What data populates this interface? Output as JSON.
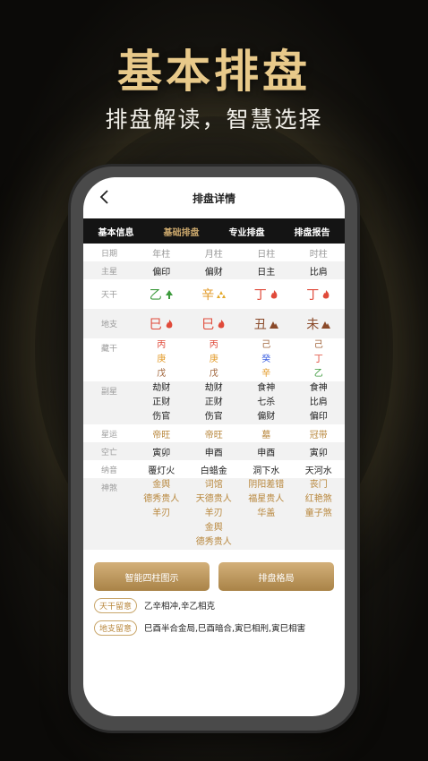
{
  "hero": {
    "title": "基本排盘",
    "subtitle": "排盘解读，智慧选择"
  },
  "nav": {
    "title": "排盘详情"
  },
  "tabs": [
    {
      "label": "基本信息",
      "active": false
    },
    {
      "label": "基础排盘",
      "active": true
    },
    {
      "label": "专业排盘",
      "active": false
    },
    {
      "label": "排盘报告",
      "active": false
    }
  ],
  "table": {
    "header": {
      "label": "日期",
      "cols": [
        "年柱",
        "月柱",
        "日柱",
        "时柱"
      ]
    },
    "zhuxing": {
      "label": "主星",
      "cols": [
        "偏印",
        "偏财",
        "日主",
        "比肩"
      ]
    },
    "tiangan": {
      "label": "天干",
      "cols": [
        {
          "char": "乙",
          "icon": "tree-icon",
          "color": "#3c9a3c"
        },
        {
          "char": "辛",
          "icon": "gold-icon",
          "color": "#e39b2a"
        },
        {
          "char": "丁",
          "icon": "fire-icon",
          "color": "#e04a3a"
        },
        {
          "char": "丁",
          "icon": "fire-icon",
          "color": "#e04a3a"
        }
      ]
    },
    "dizhi": {
      "label": "地支",
      "cols": [
        {
          "char": "巳",
          "icon": "fire-icon",
          "color": "#e04a3a"
        },
        {
          "char": "巳",
          "icon": "fire-icon",
          "color": "#e04a3a"
        },
        {
          "char": "丑",
          "icon": "mountain-icon",
          "color": "#8a4a2a"
        },
        {
          "char": "未",
          "icon": "mountain-icon",
          "color": "#8a4a2a"
        }
      ]
    },
    "canggan": {
      "label": "藏干",
      "cols": [
        [
          "丙",
          "庚",
          "戊"
        ],
        [
          "丙",
          "庚",
          "戊"
        ],
        [
          "己",
          "癸",
          "辛"
        ],
        [
          "己",
          "丁",
          "乙"
        ]
      ]
    },
    "fuxing": {
      "label": "副星",
      "cols": [
        [
          "劫财",
          "正财",
          "伤官"
        ],
        [
          "劫财",
          "正财",
          "伤官"
        ],
        [
          "食神",
          "七杀",
          "偏财"
        ],
        [
          "食神",
          "比肩",
          "偏印"
        ]
      ]
    },
    "xingyun": {
      "label": "星运",
      "cols": [
        "帝旺",
        "帝旺",
        "墓",
        "冠带"
      ]
    },
    "kongwang": {
      "label": "空亡",
      "cols": [
        "寅卯",
        "申酉",
        "申酉",
        "寅卯"
      ]
    },
    "nayin": {
      "label": "纳音",
      "cols": [
        "覆灯火",
        "白蜡金",
        "洞下水",
        "天河水"
      ]
    },
    "shensha": {
      "label": "神煞",
      "cols": [
        [
          "金舆",
          "德秀贵人",
          "羊刃"
        ],
        [
          "词馆",
          "天德贵人",
          "羊刃",
          "金舆",
          "德秀贵人"
        ],
        [
          "阴阳差错",
          "福星贵人",
          "华盖"
        ],
        [
          "丧门",
          "红艳煞",
          "童子煞"
        ]
      ]
    }
  },
  "buttons": {
    "left": "智能四柱图示",
    "right": "排盘格局"
  },
  "notes": [
    {
      "tag": "天干留意",
      "text": "乙辛相冲,辛乙相克"
    },
    {
      "tag": "地支留意",
      "text": "巳酉半合金局,巳酉暗合,寅巳相刑,寅巳相害"
    }
  ]
}
